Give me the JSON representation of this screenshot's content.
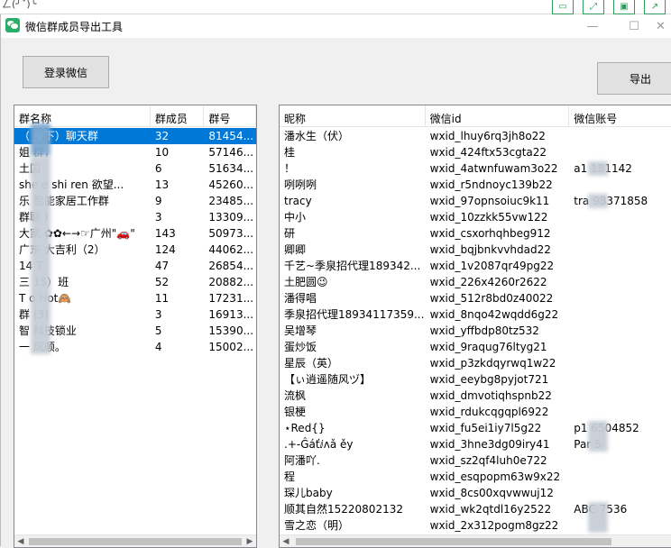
{
  "window": {
    "title": "微信群成员导出工具",
    "behind_fragment": "ㄥ(╯ˇ)╰"
  },
  "buttons": {
    "login": "登录微信",
    "export": "导出"
  },
  "controls": {
    "minimize": "—",
    "maximize": "☐",
    "close": "✕"
  },
  "groups": {
    "columns": [
      "群名称",
      "群成员",
      "群号"
    ],
    "rows": [
      {
        "name": "（ 身下）聊天群",
        "members": "32",
        "id": "81454...",
        "selected": true
      },
      {
        "name": "姐 群，",
        "members": "10",
        "id": "57146..."
      },
      {
        "name": "土国",
        "members": "6",
        "id": "51634..."
      },
      {
        "name": "she   e shi ren  欲望...",
        "members": "13",
        "id": "45260..."
      },
      {
        "name": "乐  智能家居工作群",
        "members": "9",
        "id": "23485..."
      },
      {
        "name": "群聊 )",
        "members": "3",
        "id": "13309..."
      },
      {
        "name": "大家  ✿✿←→☞广州\"🚗\"",
        "members": "143",
        "id": "50973..."
      },
      {
        "name": "广东   大吉利（2）",
        "members": "124",
        "id": "44062..."
      },
      {
        "name": "14   T",
        "members": "47",
        "id": "26854..."
      },
      {
        "name": "三   15）班",
        "members": "52",
        "id": "20882..."
      },
      {
        "name": "T   o Hot🙈",
        "members": "11",
        "id": "17231..."
      },
      {
        "name": "群  (3)",
        "members": "3",
        "id": "16913..."
      },
      {
        "name": "智   科技锁业",
        "members": "5",
        "id": "15390..."
      },
      {
        "name": "一   风顺。",
        "members": "4",
        "id": "15002..."
      }
    ]
  },
  "members": {
    "columns": [
      "昵称",
      "微信id",
      "微信账号"
    ],
    "rows": [
      {
        "nick": "潘水生（伏）",
        "wxid": "wxid_lhuy6rq3jh8o22",
        "account": ""
      },
      {
        "nick": "桂",
        "wxid": "wxid_424ftx53cgta22",
        "account": ""
      },
      {
        "nick": "！",
        "wxid": "wxid_4atwnfuwam3o22",
        "account": "a1      181142"
      },
      {
        "nick": "咧咧咧",
        "wxid": "wxid_r5ndnoyc139b22",
        "account": ""
      },
      {
        "nick": "tracy",
        "wxid": "wxid_97opnsoiuc9k11",
        "account": "tra      98371858"
      },
      {
        "nick": "中小",
        "wxid": "wxid_10zzkk55vw122",
        "account": ""
      },
      {
        "nick": "研",
        "wxid": "wxid_csxorhqhbeg912",
        "account": ""
      },
      {
        "nick": "卿卿",
        "wxid": "wxid_bqjbnkvvhdad22",
        "account": ""
      },
      {
        "nick": "千艺~季泉招代理189342...",
        "wxid": "wxid_1v2087qr49pg22",
        "account": ""
      },
      {
        "nick": "土肥圆😉",
        "wxid": "wxid_226x4260r2622",
        "account": ""
      },
      {
        "nick": "潘得唱",
        "wxid": "wxid_512r8bd0z40022",
        "account": ""
      },
      {
        "nick": "季泉招代理18934117359...",
        "wxid": "wxid_8nqo42wqdd6g22",
        "account": ""
      },
      {
        "nick": "吴增琴",
        "wxid": "wxid_yffbdp80tz532",
        "account": ""
      },
      {
        "nick": "蛋炒饭",
        "wxid": "wxid_9raqug76ltyg21",
        "account": ""
      },
      {
        "nick": "星辰（英）",
        "wxid": "wxid_p3zkdqyrwq1w22",
        "account": ""
      },
      {
        "nick": "【ぃ逍遥随风ヅ】",
        "wxid": "wxid_eeybg8pyjot721",
        "account": ""
      },
      {
        "nick": "流枫",
        "wxid": "wxid_dmvotiqhspnb22",
        "account": ""
      },
      {
        "nick": "银梗",
        "wxid": "wxid_rdukcqgqpl6922",
        "account": ""
      },
      {
        "nick": "⋆Red{}",
        "wxid": "wxid_fu5ei1iy7l5g22",
        "account": "p1      6504852"
      },
      {
        "nick": ".+-Ĝáťⅈᴧǎ ěy",
        "wxid": "wxid_3hne3dg09iry41",
        "account": "Par     5"
      },
      {
        "nick": "阿潘吖.",
        "wxid": "wxid_sz2qf4luh0e722",
        "account": ""
      },
      {
        "nick": "程",
        "wxid": "wxid_esqpopm63w9x22",
        "account": ""
      },
      {
        "nick": "琛儿baby",
        "wxid": "wxid_8cs00xqvwwuj12",
        "account": ""
      },
      {
        "nick": "顺其自然15220802132",
        "wxid": "wxid_wk2qtdl16y2522",
        "account": "ABC     7536"
      },
      {
        "nick": "雪之恋（明）",
        "wxid": "wxid_2x312pogm8gz22",
        "account": ""
      }
    ]
  }
}
